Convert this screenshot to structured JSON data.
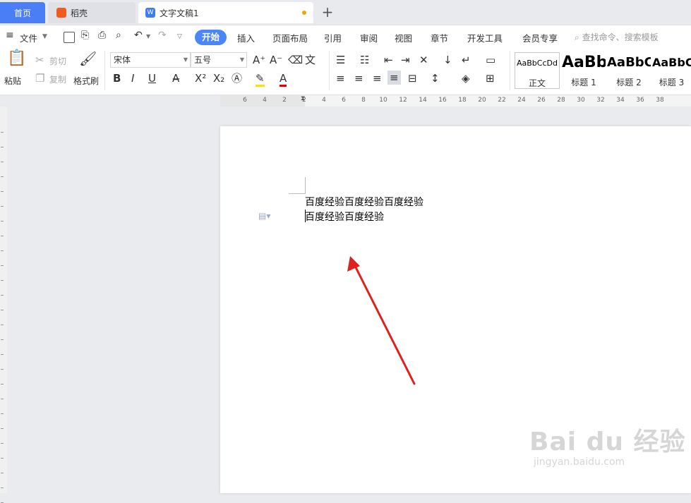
{
  "tabs": {
    "home": "首页",
    "daoke": "稻壳",
    "doc": "文字文稿1",
    "add": "+"
  },
  "menu": {
    "file": "文件",
    "items": [
      "开始",
      "插入",
      "页面布局",
      "引用",
      "审阅",
      "视图",
      "章节",
      "开发工具",
      "会员专享"
    ],
    "search_placeholder": "查找命令、搜索模板"
  },
  "ribbon": {
    "paste": "粘贴",
    "cut": "剪切",
    "copy": "复制",
    "format_painter": "格式刷",
    "font_name": "宋体",
    "font_size": "五号",
    "styles": [
      {
        "sample": "AaBbCcDd",
        "name": "正文"
      },
      {
        "sample": "AaBb",
        "name": "标题 1"
      },
      {
        "sample": "AaBbC",
        "name": "标题 2"
      },
      {
        "sample": "AaBbC",
        "name": "标题 3"
      }
    ]
  },
  "ruler": {
    "labels": [
      "6",
      "4",
      "2",
      "2",
      "4",
      "6",
      "8",
      "10",
      "12",
      "14",
      "16",
      "18",
      "20",
      "22",
      "24",
      "26",
      "28",
      "30",
      "32",
      "34",
      "36",
      "38"
    ]
  },
  "document": {
    "line1": "百度经验百度经验百度经验",
    "line2": "百度经验百度经验"
  },
  "watermark": {
    "brand": "Bai du 经验",
    "url": "jingyan.baidu.com"
  },
  "colors": {
    "accent": "#4a86f7",
    "arrow": "#e02020"
  }
}
